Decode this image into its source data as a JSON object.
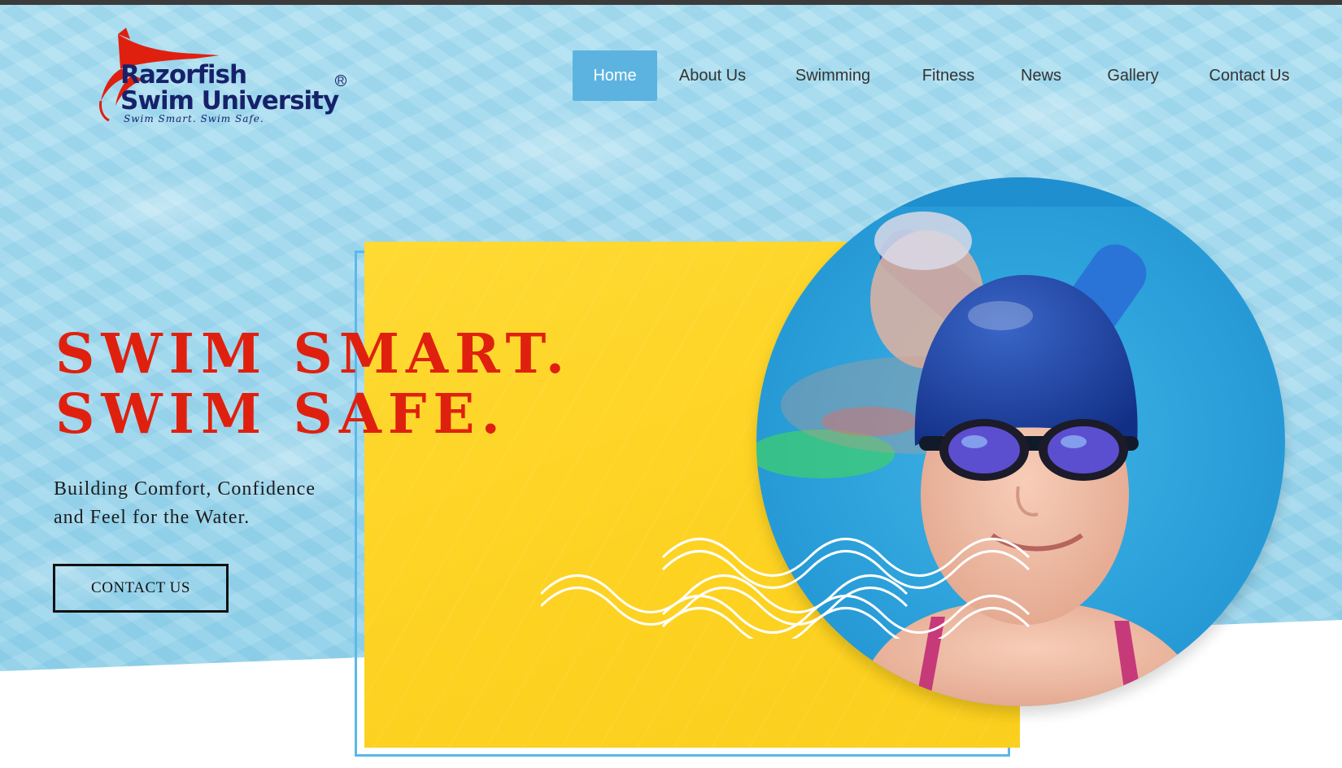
{
  "logo": {
    "line1": "Razorfish",
    "line2": "Swim University",
    "tagline": "Swim Smart. Swim Safe.",
    "registered": "R",
    "colors": {
      "text": "#17216a",
      "fish": "#e0200f"
    }
  },
  "nav": {
    "items": [
      {
        "label": "Home",
        "active": true
      },
      {
        "label": "About Us",
        "active": false
      },
      {
        "label": "Swimming",
        "active": false
      },
      {
        "label": "Fitness",
        "active": false
      },
      {
        "label": "News",
        "active": false
      },
      {
        "label": "Gallery",
        "active": false
      },
      {
        "label": "Contact Us",
        "active": false
      }
    ],
    "active_color": "#5cb3e0"
  },
  "hero": {
    "headline_line1": "SWIM SMART.",
    "headline_line2": "SWIM SAFE.",
    "subtitle_line1": "Building Comfort, Confidence",
    "subtitle_line2": "and Feel for the Water.",
    "cta_label": "CONTACT US",
    "colors": {
      "headline": "#e0200f",
      "yellow": "#fdd221",
      "water": "#9fd8ee",
      "outline": "#5bb8ea"
    }
  },
  "photo": {
    "subject": "girl-in-blue-swim-cap-and-goggles"
  }
}
